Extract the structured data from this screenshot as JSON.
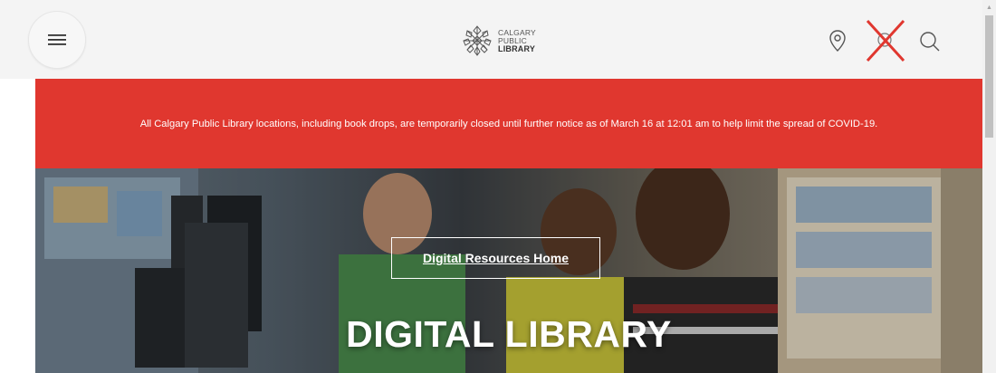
{
  "header": {
    "menu_icon": "hamburger-menu-icon",
    "logo": {
      "line1": "CALGARY",
      "line2": "PUBLIC",
      "line3": "LIBRARY"
    },
    "location_icon": "map-pin-icon",
    "overlay_icon": "red-x-mark",
    "search_icon": "search-icon"
  },
  "alert": {
    "text": "All Calgary Public Library locations, including book drops, are temporarily closed until further notice as of March 16 at 12:01 am to help limit the spread of COVID-19.",
    "background_color": "#e0372f"
  },
  "hero": {
    "link_label": "Digital Resources Home",
    "title": "DIGITAL LIBRARY"
  },
  "scrollbar": {
    "up_arrow_icon": "scroll-up-arrow-icon"
  }
}
